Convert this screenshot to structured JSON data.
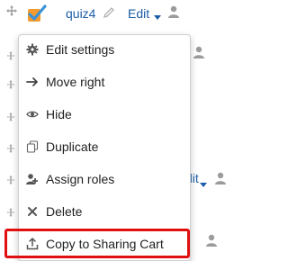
{
  "activity": {
    "name": "quiz4",
    "edit_label": "Edit",
    "background_edit_label": "dit"
  },
  "menu": {
    "items": [
      {
        "label": "Edit settings",
        "icon": "gear-icon"
      },
      {
        "label": "Move right",
        "icon": "arrow-right-icon"
      },
      {
        "label": "Hide",
        "icon": "eye-icon"
      },
      {
        "label": "Duplicate",
        "icon": "duplicate-icon"
      },
      {
        "label": "Assign roles",
        "icon": "assign-roles-icon"
      },
      {
        "label": "Delete",
        "icon": "delete-icon"
      },
      {
        "label": "Copy to Sharing Cart",
        "icon": "share-upload-icon"
      }
    ]
  },
  "colors": {
    "link": "#1b5ea8",
    "checkbox_check": "#3a93d6",
    "checkbox_bg": "#f59b2e",
    "highlight": "#e01010",
    "icon_gray": "#9b9b9b"
  }
}
